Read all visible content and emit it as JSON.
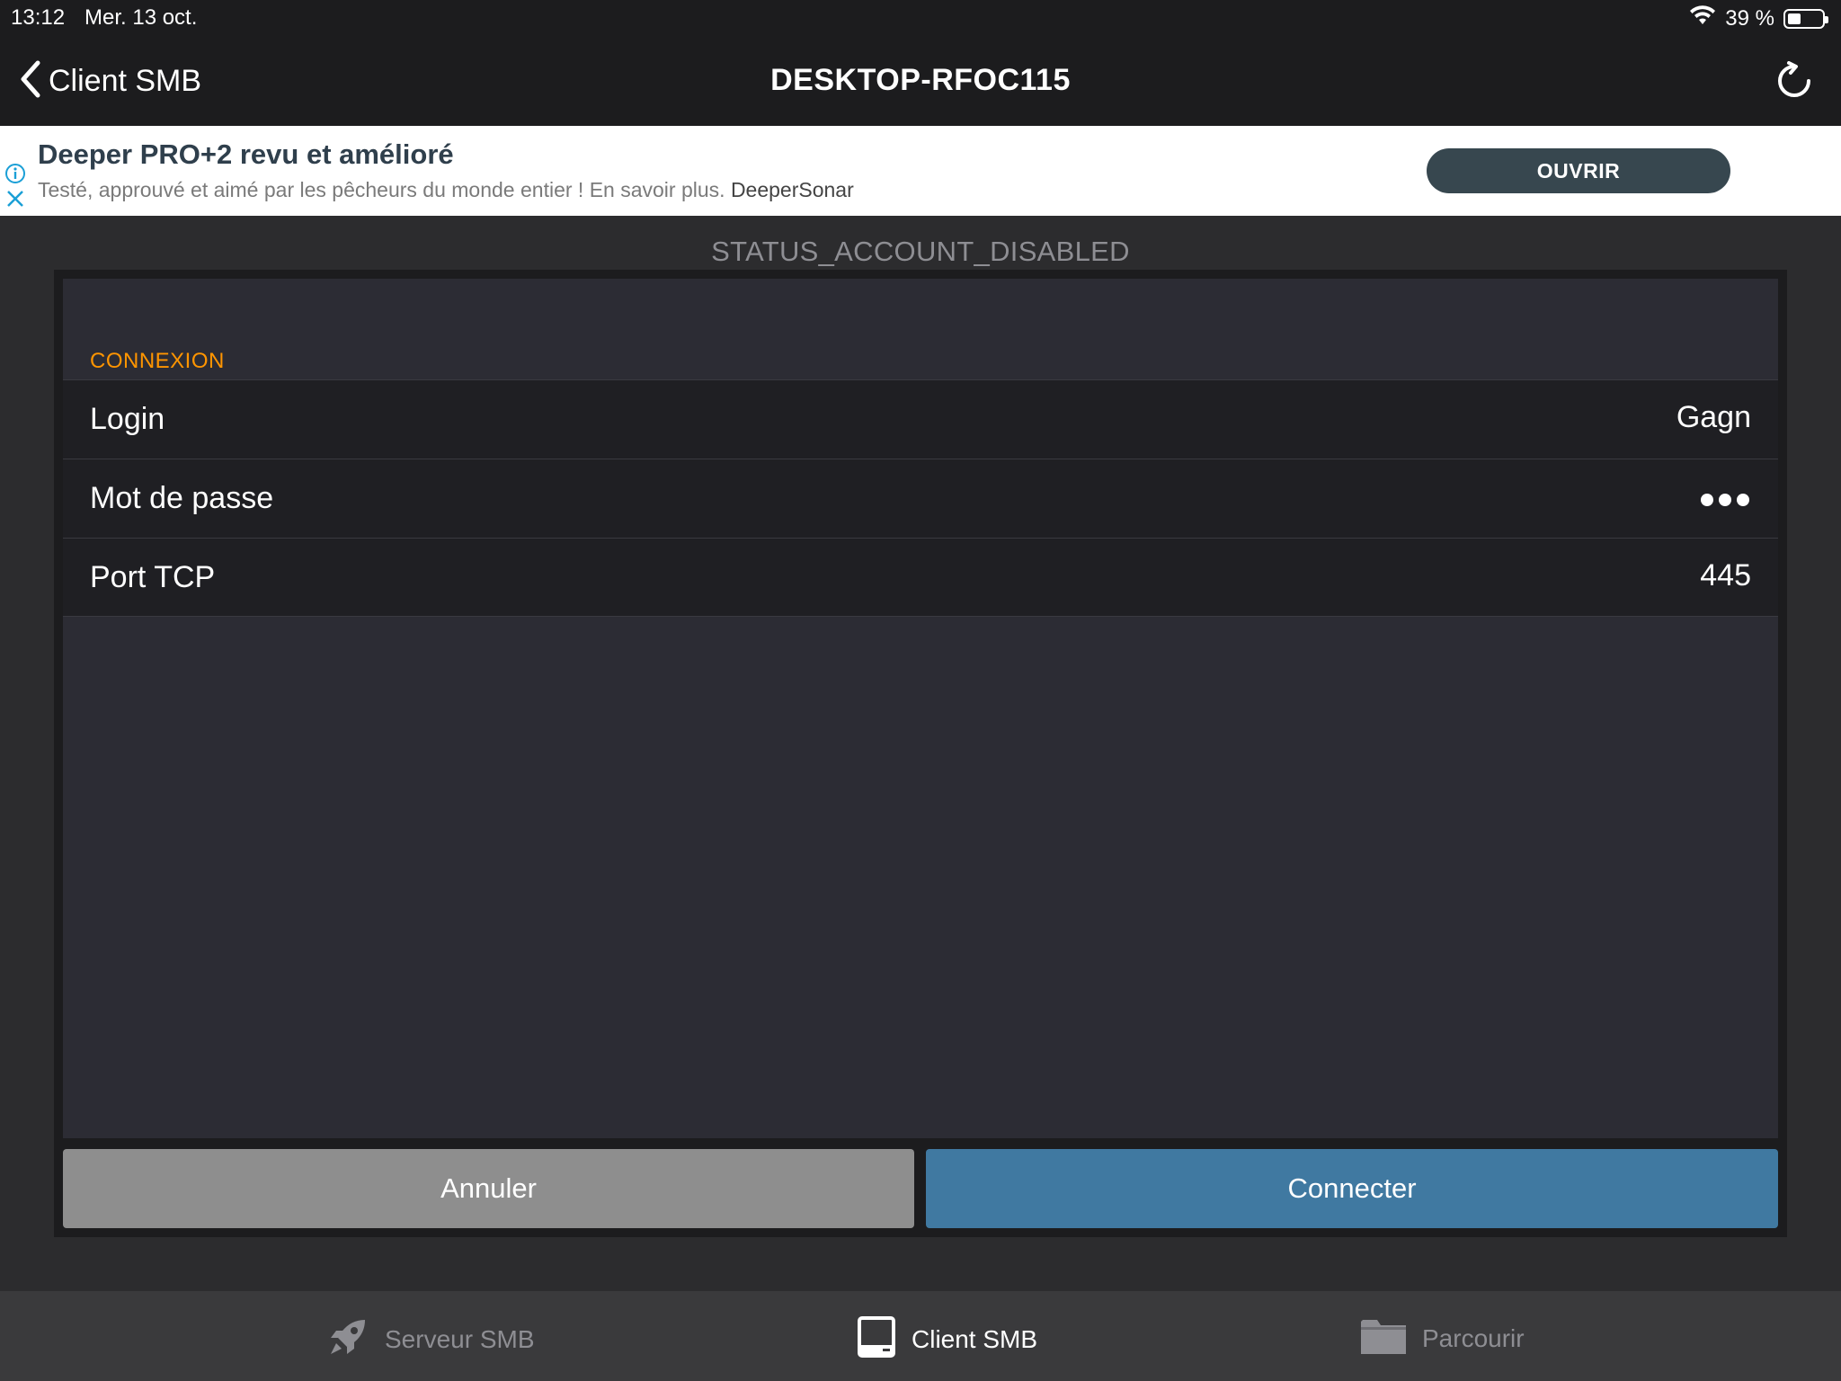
{
  "status_bar": {
    "time": "13:12",
    "date": "Mer. 13 oct.",
    "battery": "39 %",
    "battery_level": 0.39
  },
  "nav": {
    "back_label": "Client SMB",
    "title": "DESKTOP-RFOC115"
  },
  "ad": {
    "title": "Deeper PRO+2 revu et amélioré",
    "description": "Testé, approuvé et aimé par les pêcheurs du monde entier ! En savoir plus.",
    "brand": "DeeperSonar",
    "button": "OUVRIR"
  },
  "status_message": "STATUS_ACCOUNT_DISABLED",
  "form": {
    "section": "CONNEXION",
    "rows": [
      {
        "label": "Login",
        "value": "Gagn"
      },
      {
        "label": "Mot de passe",
        "value": ""
      },
      {
        "label": "Port TCP",
        "value": "445"
      }
    ]
  },
  "buttons": {
    "cancel": "Annuler",
    "connect": "Connecter"
  },
  "tabs": [
    {
      "label": "Serveur SMB",
      "icon": "rocket-icon"
    },
    {
      "label": "Client SMB",
      "icon": "laptop-icon"
    },
    {
      "label": "Parcourir",
      "icon": "folder-icon"
    }
  ],
  "colors": {
    "accent_orange": "#ff9500",
    "connect_blue": "#4079a1",
    "ad_button": "#37474f"
  }
}
